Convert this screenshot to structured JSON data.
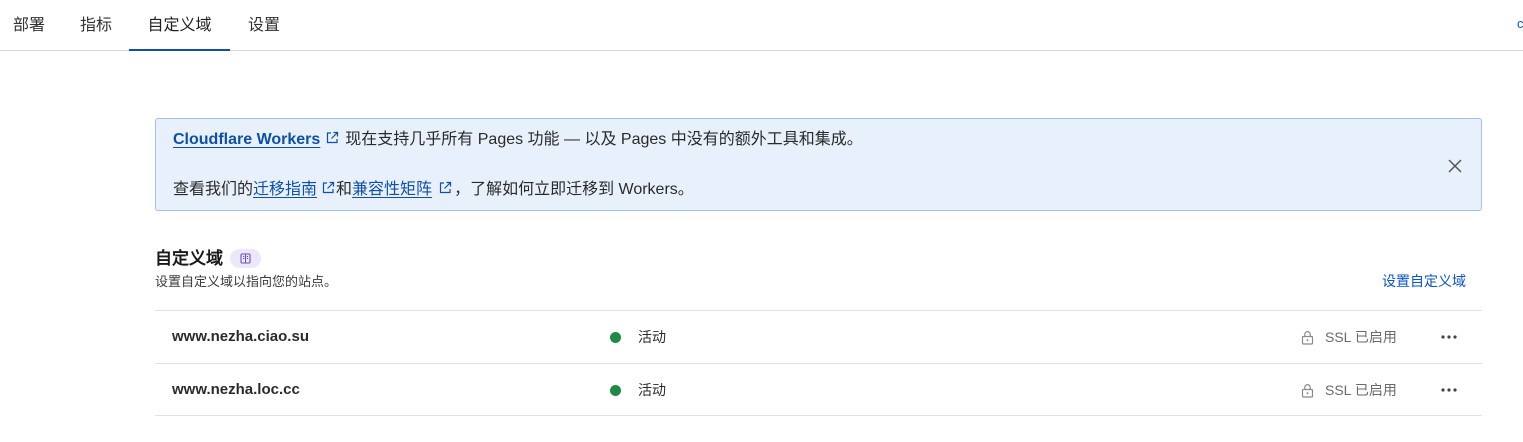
{
  "tabs": [
    {
      "label": "部署"
    },
    {
      "label": "指标"
    },
    {
      "label": "自定义域"
    },
    {
      "label": "设置"
    }
  ],
  "edge_glyph": "c",
  "banner": {
    "line1_link": "Cloudflare Workers",
    "line1_text": "现在支持几乎所有 Pages 功能 — 以及 Pages 中没有的额外工具和集成。",
    "line2_prefix": "查看我们的",
    "line2_link1": "迁移指南",
    "line2_mid": "和",
    "line2_link2": "兼容性矩阵",
    "line2_suffix": "，了解如何立即迁移到 Workers。"
  },
  "section": {
    "title": "自定义域",
    "subtitle": "设置自定义域以指向您的站点。",
    "setup_link": "设置自定义域"
  },
  "domains": [
    {
      "name": "www.nezha.ciao.su",
      "status": "活动",
      "ssl": "SSL 已启用"
    },
    {
      "name": "www.nezha.loc.cc",
      "status": "活动",
      "ssl": "SSL 已启用"
    }
  ],
  "colors": {
    "accent": "#0e4fa8",
    "link": "#0b55c7",
    "banner_bg": "#e8f1fb",
    "banner_border": "#9fc2ea",
    "status_active": "#1f8a45"
  },
  "icons": {
    "external": "external-link-icon",
    "close": "close-icon",
    "docs": "book-icon",
    "lock": "lock-icon",
    "more": "more-horizontal-icon"
  }
}
